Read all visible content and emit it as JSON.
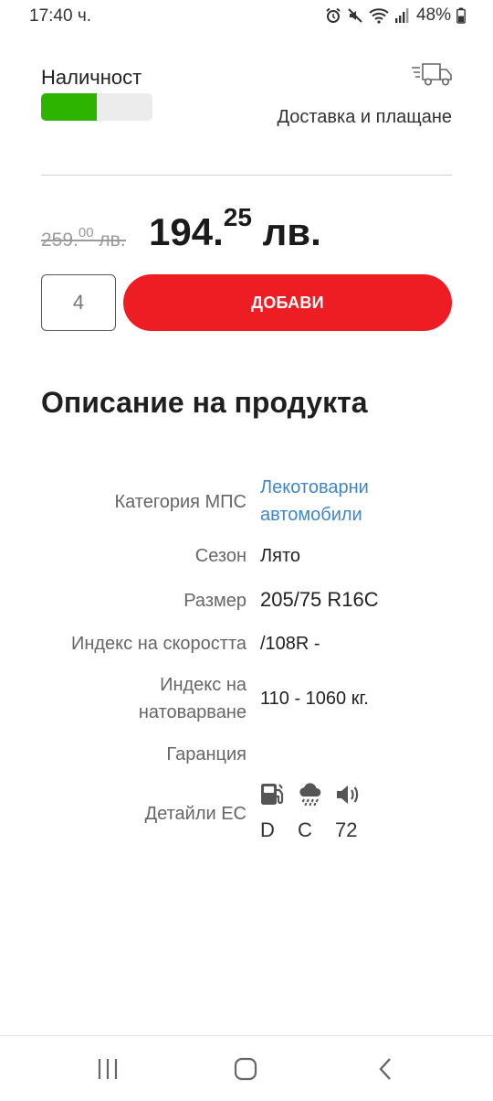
{
  "status": {
    "time": "17:40 ч.",
    "battery": "48%",
    "icons": [
      "alarm-icon",
      "mute-icon",
      "wifi-icon",
      "signal-icon",
      "battery-icon"
    ]
  },
  "availability": {
    "label": "Наличност",
    "level": 0.5,
    "fill_color": "#2db400"
  },
  "delivery": {
    "icon": "truck-icon",
    "label": "Доставка и плащане"
  },
  "price": {
    "old_main": "259.",
    "old_cents": "00",
    "old_currency": " лв.",
    "new_main": "194.",
    "new_cents": "25",
    "new_currency": " лв."
  },
  "cart": {
    "quantity": "4",
    "add_label": "ДОБАВИ",
    "button_color": "#ee1d23"
  },
  "description": {
    "title": "Описание на продукта",
    "specs": [
      {
        "label": "Категория МПС",
        "value_line1": "Лекотоварни",
        "value_line2": "автомобили"
      },
      {
        "label": "Сезон",
        "value": "Лято"
      },
      {
        "label": "Размер",
        "value": "205/75 R16C"
      },
      {
        "label": "Индекс на скоростта",
        "value": "/108R -"
      },
      {
        "label_line1": "Индекс на",
        "label_line2": "натоварване",
        "value": "110 - 1060 кг."
      },
      {
        "label": "Гаранция",
        "value": ""
      },
      {
        "label": "Детайли ЕС"
      }
    ],
    "eu": {
      "fuel_icon": "fuel-pump-icon",
      "fuel": "D",
      "wet_icon": "rain-cloud-icon",
      "wet": "C",
      "noise_icon": "speaker-icon",
      "noise": "72"
    },
    "link_color": "#3f86c8"
  },
  "nav": {
    "buttons": [
      "recent-apps",
      "home",
      "back"
    ]
  }
}
